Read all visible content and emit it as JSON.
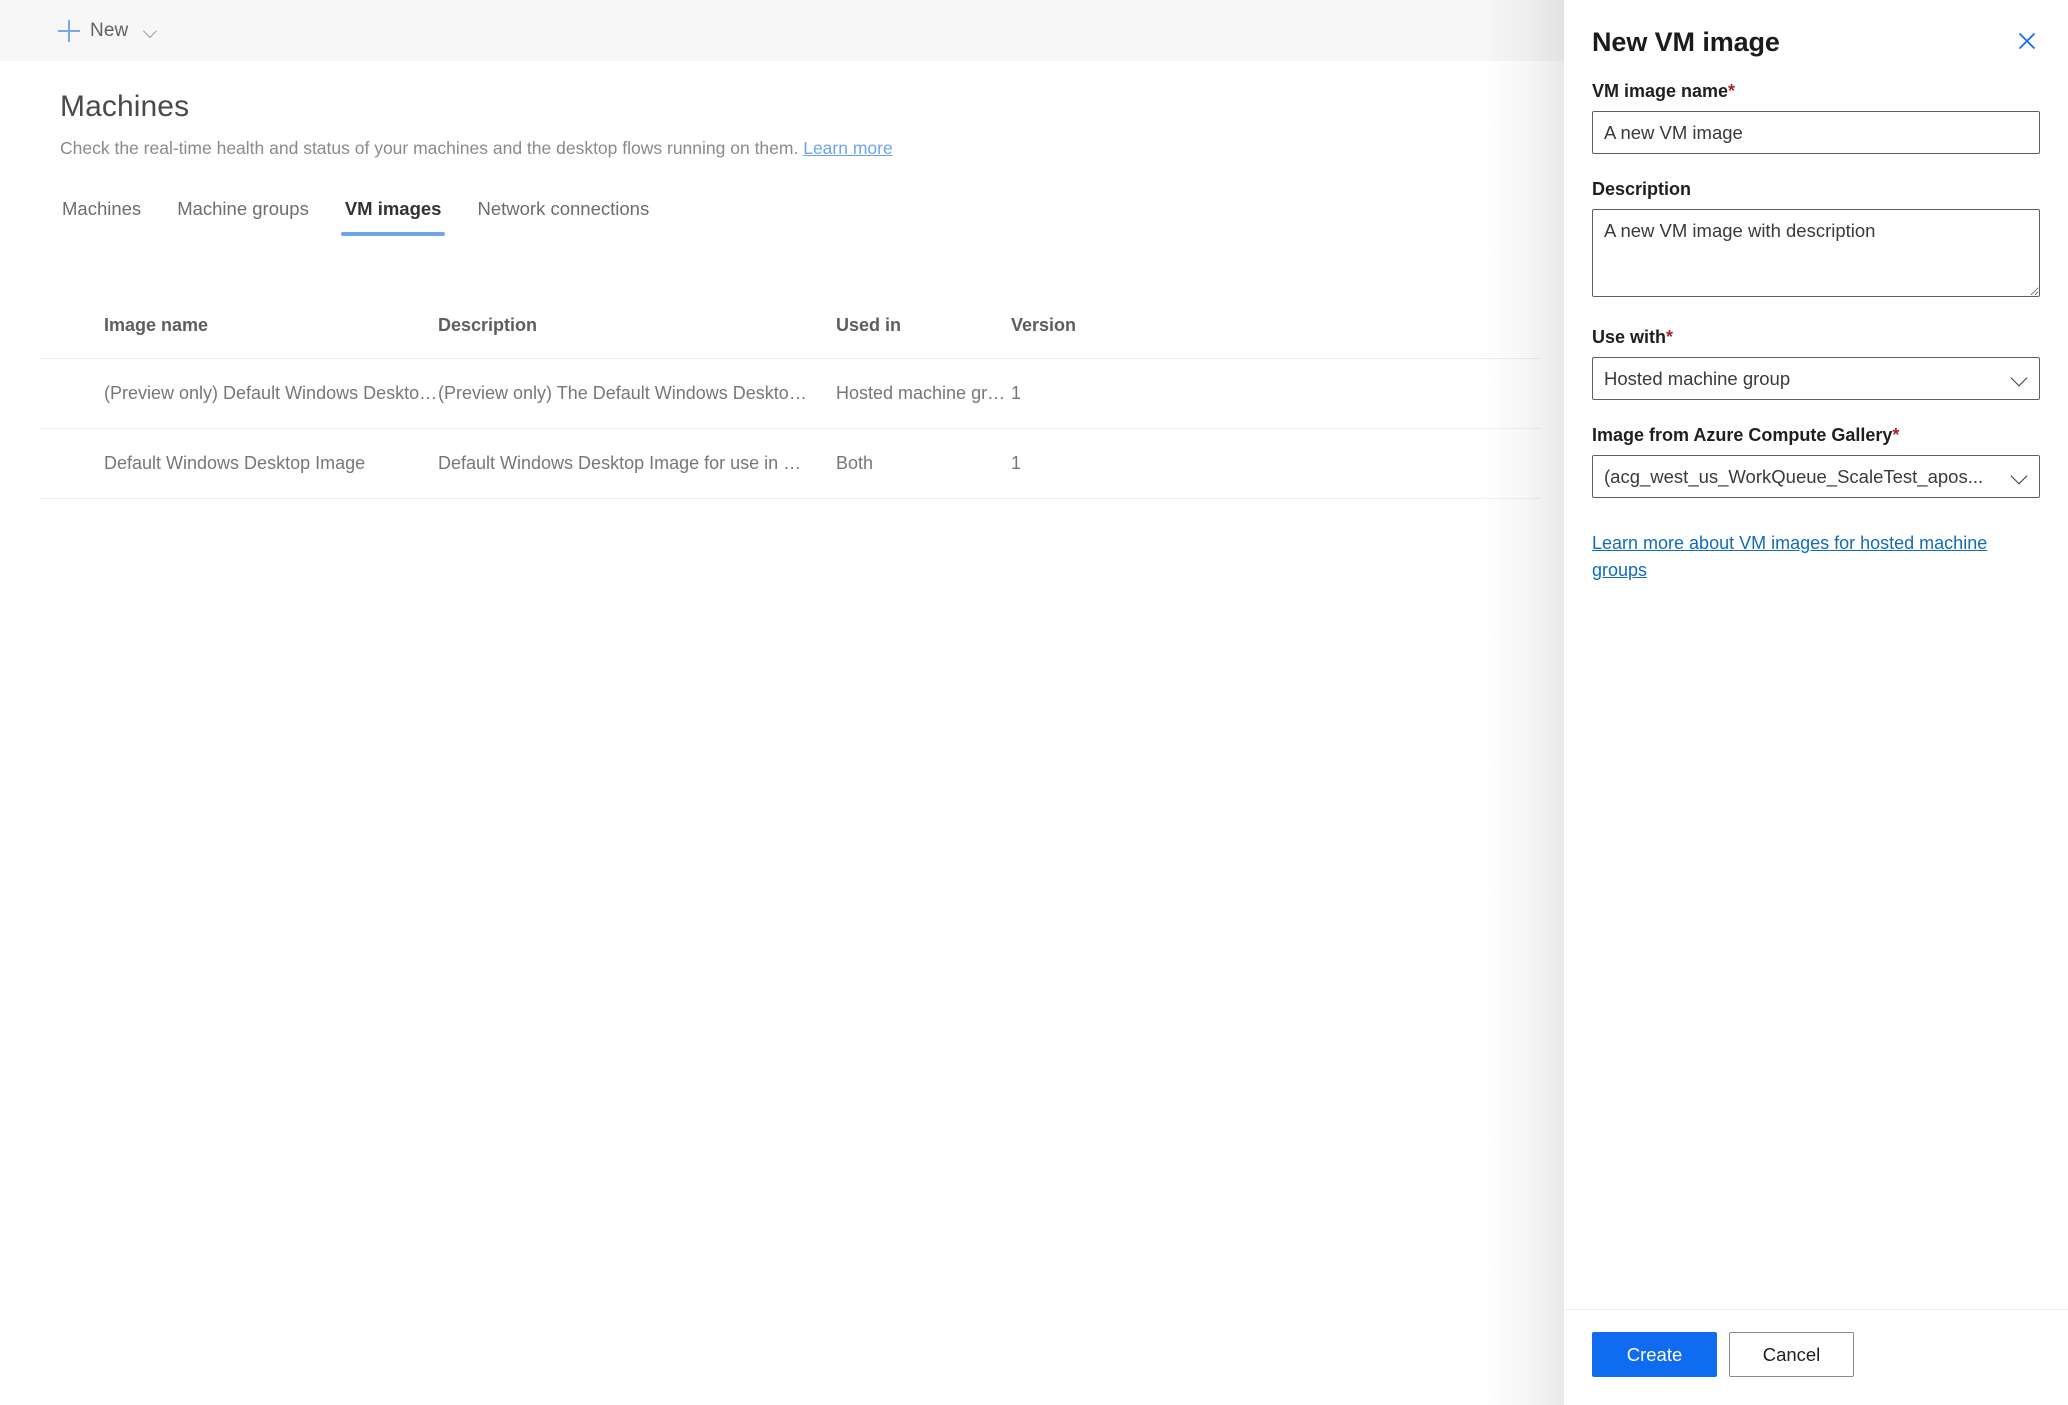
{
  "commandbar": {
    "new_label": "New",
    "plus_icon": "plus-icon",
    "chevron_icon": "chevron-down-icon"
  },
  "page": {
    "title": "Machines",
    "subtitle": "Check the real-time health and status of your machines and the desktop flows running on them.",
    "learn_more": "Learn more"
  },
  "tabs": [
    {
      "label": "Machines",
      "active": false
    },
    {
      "label": "Machine groups",
      "active": false
    },
    {
      "label": "VM images",
      "active": true
    },
    {
      "label": "Network connections",
      "active": false
    }
  ],
  "table": {
    "columns": [
      "Image name",
      "Description",
      "Used in",
      "Version"
    ],
    "rows": [
      {
        "name": "(Preview only) Default Windows Desktop Ima...",
        "description": "(Preview only) The Default Windows Desktop Image for use i...",
        "used_in": "Hosted machine group",
        "version": "1"
      },
      {
        "name": "Default Windows Desktop Image",
        "description": "Default Windows Desktop Image for use in Microsoft Deskto...",
        "used_in": "Both",
        "version": "1"
      }
    ]
  },
  "panel": {
    "title": "New VM image",
    "close_icon": "close-icon",
    "fields": {
      "vm_image_name": {
        "label": "VM image name",
        "required": "*",
        "value": "A new VM image",
        "placeholder": "VM image name"
      },
      "description": {
        "label": "Description",
        "value": "A new VM image with description",
        "placeholder": "Description"
      },
      "use_with": {
        "label": "Use with",
        "required": "*",
        "value": "Hosted machine group",
        "chevron_icon": "chevron-down-icon"
      },
      "image_gallery": {
        "label": "Image from Azure Compute Gallery",
        "required": "*",
        "value": "(acg_west_us_WorkQueue_ScaleTest_apos...",
        "chevron_icon": "chevron-down-icon"
      }
    },
    "learn_link": "Learn more about VM images for hosted machine groups",
    "buttons": {
      "create": "Create",
      "cancel": "Cancel"
    }
  },
  "colors": {
    "accent_blue": "#0f6cf0",
    "tab_underline": "#6fa4e8",
    "link_blue": "#0f6cbd",
    "required_red": "#a4262c",
    "commandbar_bg": "#f7f7f7"
  }
}
